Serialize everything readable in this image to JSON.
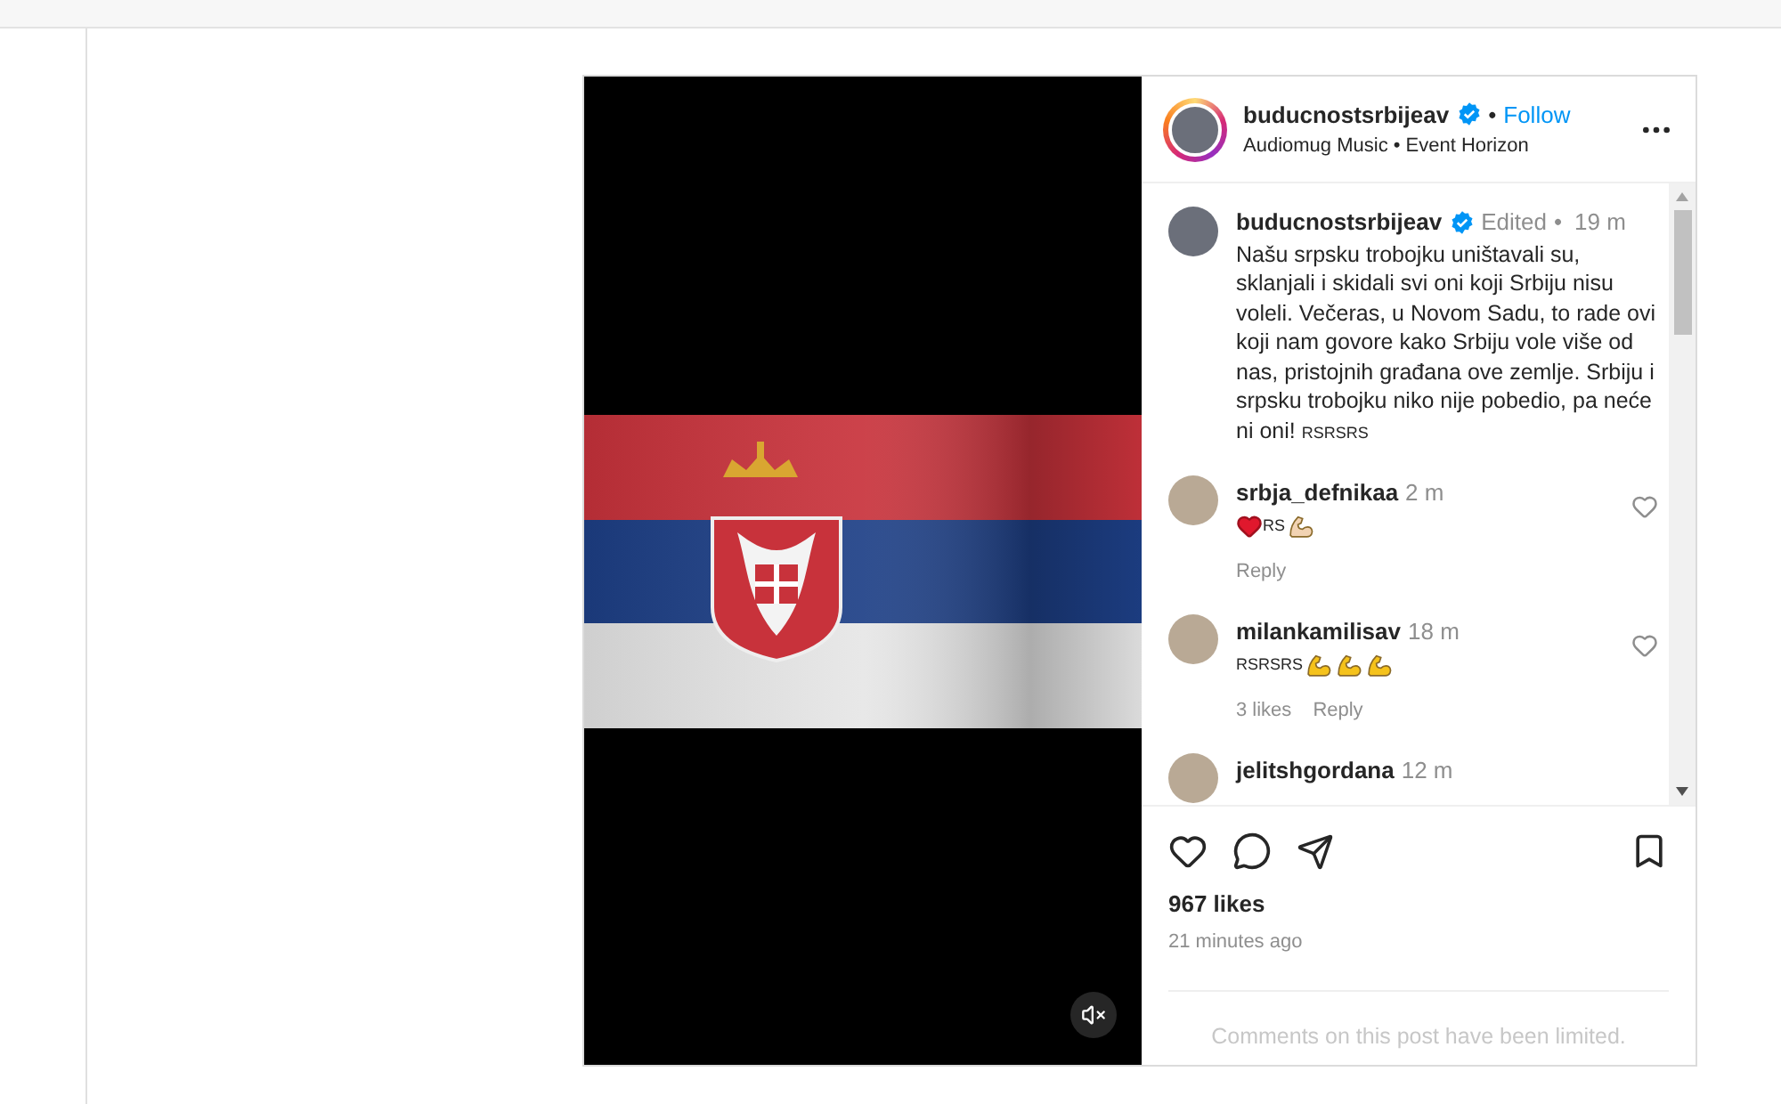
{
  "post": {
    "author": {
      "username": "buducnostsrbijeav",
      "verified": true,
      "separator": "•",
      "follow": "Follow",
      "audio": "Audiomug Music • Event Horizon"
    },
    "caption": {
      "username": "buducnostsrbijeav",
      "verified": true,
      "edited": "Edited",
      "separator": "•",
      "time": "19 m",
      "text": "Našu srpsku trobojku uništavali su, sklanjali i skidali svi oni koji Srbiju nisu voleli. Večeras, u Novom Sadu, to rade ovi koji nam govore kako Srbiju vole više od nas, pristojnih građana ove zemlje. Srbiju i srpsku trobojku niko nije pobedio, pa neće ni oni!",
      "flag_text": "RSRSRS"
    },
    "comments": [
      {
        "username": "srbja_defnikaa",
        "time": "2 m",
        "content": [
          {
            "kind": "heart"
          },
          {
            "kind": "text",
            "text": "RS"
          },
          {
            "kind": "flex",
            "color": "#f2d3b3"
          }
        ],
        "reply": "Reply"
      },
      {
        "username": "milankamilisav",
        "time": "18 m",
        "content": [
          {
            "kind": "text",
            "text": "RSRSRS"
          },
          {
            "kind": "flex",
            "color": "#f5c21b"
          },
          {
            "kind": "flex",
            "color": "#f5c21b"
          },
          {
            "kind": "flex",
            "color": "#f5c21b"
          }
        ],
        "likes": "3 likes",
        "reply": "Reply"
      },
      {
        "username": "jelitshgordana",
        "time": "12 m"
      }
    ],
    "likes": "967 likes",
    "posted": "21 minutes ago",
    "limited": "Comments on this post have been limited.",
    "saved": false,
    "liked": false,
    "muted": true
  }
}
